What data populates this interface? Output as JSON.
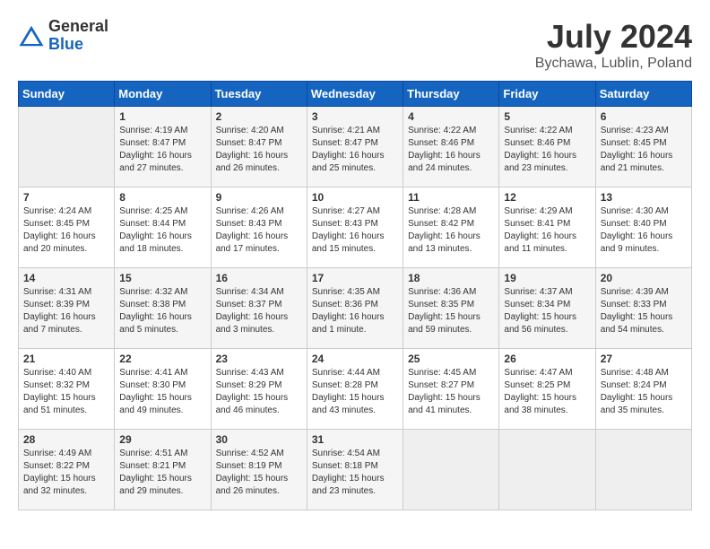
{
  "header": {
    "logo_general": "General",
    "logo_blue": "Blue",
    "month_title": "July 2024",
    "location": "Bychawa, Lublin, Poland"
  },
  "weekdays": [
    "Sunday",
    "Monday",
    "Tuesday",
    "Wednesday",
    "Thursday",
    "Friday",
    "Saturday"
  ],
  "weeks": [
    [
      {
        "day": "",
        "info": ""
      },
      {
        "day": "1",
        "info": "Sunrise: 4:19 AM\nSunset: 8:47 PM\nDaylight: 16 hours\nand 27 minutes."
      },
      {
        "day": "2",
        "info": "Sunrise: 4:20 AM\nSunset: 8:47 PM\nDaylight: 16 hours\nand 26 minutes."
      },
      {
        "day": "3",
        "info": "Sunrise: 4:21 AM\nSunset: 8:47 PM\nDaylight: 16 hours\nand 25 minutes."
      },
      {
        "day": "4",
        "info": "Sunrise: 4:22 AM\nSunset: 8:46 PM\nDaylight: 16 hours\nand 24 minutes."
      },
      {
        "day": "5",
        "info": "Sunrise: 4:22 AM\nSunset: 8:46 PM\nDaylight: 16 hours\nand 23 minutes."
      },
      {
        "day": "6",
        "info": "Sunrise: 4:23 AM\nSunset: 8:45 PM\nDaylight: 16 hours\nand 21 minutes."
      }
    ],
    [
      {
        "day": "7",
        "info": "Sunrise: 4:24 AM\nSunset: 8:45 PM\nDaylight: 16 hours\nand 20 minutes."
      },
      {
        "day": "8",
        "info": "Sunrise: 4:25 AM\nSunset: 8:44 PM\nDaylight: 16 hours\nand 18 minutes."
      },
      {
        "day": "9",
        "info": "Sunrise: 4:26 AM\nSunset: 8:43 PM\nDaylight: 16 hours\nand 17 minutes."
      },
      {
        "day": "10",
        "info": "Sunrise: 4:27 AM\nSunset: 8:43 PM\nDaylight: 16 hours\nand 15 minutes."
      },
      {
        "day": "11",
        "info": "Sunrise: 4:28 AM\nSunset: 8:42 PM\nDaylight: 16 hours\nand 13 minutes."
      },
      {
        "day": "12",
        "info": "Sunrise: 4:29 AM\nSunset: 8:41 PM\nDaylight: 16 hours\nand 11 minutes."
      },
      {
        "day": "13",
        "info": "Sunrise: 4:30 AM\nSunset: 8:40 PM\nDaylight: 16 hours\nand 9 minutes."
      }
    ],
    [
      {
        "day": "14",
        "info": "Sunrise: 4:31 AM\nSunset: 8:39 PM\nDaylight: 16 hours\nand 7 minutes."
      },
      {
        "day": "15",
        "info": "Sunrise: 4:32 AM\nSunset: 8:38 PM\nDaylight: 16 hours\nand 5 minutes."
      },
      {
        "day": "16",
        "info": "Sunrise: 4:34 AM\nSunset: 8:37 PM\nDaylight: 16 hours\nand 3 minutes."
      },
      {
        "day": "17",
        "info": "Sunrise: 4:35 AM\nSunset: 8:36 PM\nDaylight: 16 hours\nand 1 minute."
      },
      {
        "day": "18",
        "info": "Sunrise: 4:36 AM\nSunset: 8:35 PM\nDaylight: 15 hours\nand 59 minutes."
      },
      {
        "day": "19",
        "info": "Sunrise: 4:37 AM\nSunset: 8:34 PM\nDaylight: 15 hours\nand 56 minutes."
      },
      {
        "day": "20",
        "info": "Sunrise: 4:39 AM\nSunset: 8:33 PM\nDaylight: 15 hours\nand 54 minutes."
      }
    ],
    [
      {
        "day": "21",
        "info": "Sunrise: 4:40 AM\nSunset: 8:32 PM\nDaylight: 15 hours\nand 51 minutes."
      },
      {
        "day": "22",
        "info": "Sunrise: 4:41 AM\nSunset: 8:30 PM\nDaylight: 15 hours\nand 49 minutes."
      },
      {
        "day": "23",
        "info": "Sunrise: 4:43 AM\nSunset: 8:29 PM\nDaylight: 15 hours\nand 46 minutes."
      },
      {
        "day": "24",
        "info": "Sunrise: 4:44 AM\nSunset: 8:28 PM\nDaylight: 15 hours\nand 43 minutes."
      },
      {
        "day": "25",
        "info": "Sunrise: 4:45 AM\nSunset: 8:27 PM\nDaylight: 15 hours\nand 41 minutes."
      },
      {
        "day": "26",
        "info": "Sunrise: 4:47 AM\nSunset: 8:25 PM\nDaylight: 15 hours\nand 38 minutes."
      },
      {
        "day": "27",
        "info": "Sunrise: 4:48 AM\nSunset: 8:24 PM\nDaylight: 15 hours\nand 35 minutes."
      }
    ],
    [
      {
        "day": "28",
        "info": "Sunrise: 4:49 AM\nSunset: 8:22 PM\nDaylight: 15 hours\nand 32 minutes."
      },
      {
        "day": "29",
        "info": "Sunrise: 4:51 AM\nSunset: 8:21 PM\nDaylight: 15 hours\nand 29 minutes."
      },
      {
        "day": "30",
        "info": "Sunrise: 4:52 AM\nSunset: 8:19 PM\nDaylight: 15 hours\nand 26 minutes."
      },
      {
        "day": "31",
        "info": "Sunrise: 4:54 AM\nSunset: 8:18 PM\nDaylight: 15 hours\nand 23 minutes."
      },
      {
        "day": "",
        "info": ""
      },
      {
        "day": "",
        "info": ""
      },
      {
        "day": "",
        "info": ""
      }
    ]
  ]
}
